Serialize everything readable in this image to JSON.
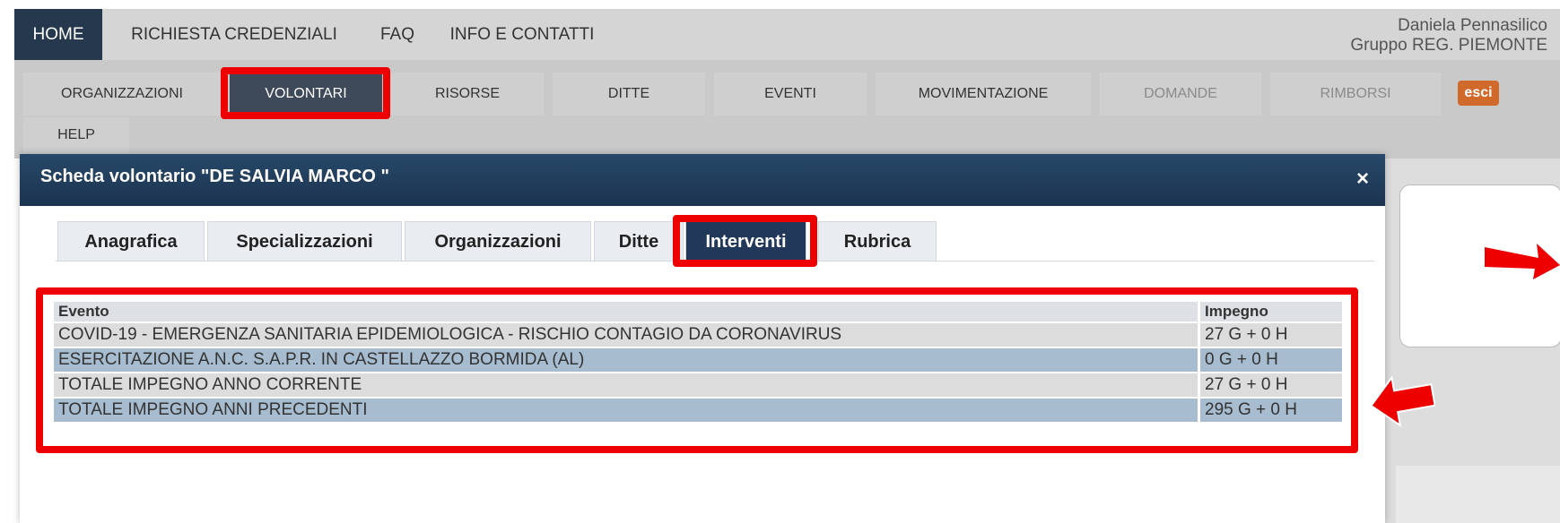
{
  "topnav": {
    "items": [
      "HOME",
      "RICHIESTA CREDENZIALI",
      "FAQ",
      "INFO E CONTATTI"
    ],
    "user_name": "Daniela Pennasilico",
    "user_group": "Gruppo REG. PIEMONTE"
  },
  "subnav": {
    "items": [
      "ORGANIZZAZIONI",
      "VOLONTARI",
      "RISORSE",
      "DITTE",
      "EVENTI",
      "MOVIMENTAZIONE",
      "DOMANDE",
      "RIMBORSI",
      "HELP"
    ],
    "logout_label": "esci"
  },
  "modal": {
    "title": "Scheda volontario \"DE SALVIA MARCO \"",
    "close": "×",
    "tabs": [
      "Anagrafica",
      "Specializzazioni",
      "Organizzazioni",
      "Ditte",
      "Interventi",
      "Rubrica"
    ],
    "active_tab": "Interventi",
    "table": {
      "headers": [
        "Evento",
        "Impegno"
      ],
      "rows": [
        [
          "COVID-19 - EMERGENZA SANITARIA EPIDEMIOLOGICA - RISCHIO CONTAGIO DA CORONAVIRUS",
          "27 G + 0 H"
        ],
        [
          "ESERCITAZIONE A.N.C. S.A.P.R. IN CASTELLAZZO BORMIDA (AL)",
          "0 G + 0 H"
        ],
        [
          "TOTALE IMPEGNO ANNO CORRENTE",
          "27 G + 0 H"
        ],
        [
          "TOTALE IMPEGNO ANNI PRECEDENTI",
          "295 G + 0 H"
        ]
      ]
    }
  },
  "colors": {
    "header_dark": "#26384d",
    "highlight_red": "#ee0000",
    "logout_orange": "#d0692a"
  }
}
